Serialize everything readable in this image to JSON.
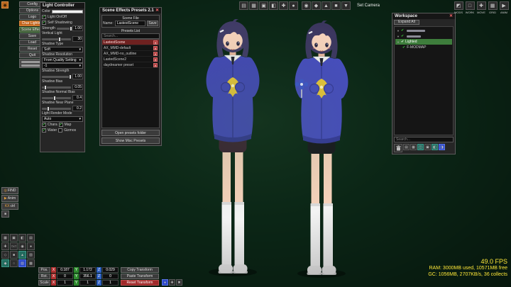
{
  "ui": {
    "dropdown_arrow": "▾",
    "check_glyph": "✔",
    "close_glyph": "✕",
    "tree_arrow": "▼"
  },
  "colors": {
    "background": "#0b2616",
    "hoodie": "#4347b5",
    "hair": "#403b66",
    "skin": "#f6d2bb",
    "shorts_left": "#3a2331",
    "shorts_right": "#17171d",
    "stats_text": "#ffe838",
    "accent_orange": "#c2641c",
    "selected_green": "#3e7d3c",
    "danger_red": "#a12a2a"
  },
  "launcher": {
    "icon": "◆"
  },
  "mod_menu": {
    "items": [
      {
        "label": "Config"
      },
      {
        "label": "Options"
      },
      {
        "label": "Logo"
      },
      {
        "label": "Char Lighting"
      },
      {
        "label": "Scene Effects"
      },
      {
        "label": "Save"
      },
      {
        "label": "Load"
      },
      {
        "label": "Reset"
      },
      {
        "label": "Quit"
      }
    ]
  },
  "light_controller": {
    "title": "Light Controller",
    "color_label": "Color",
    "light_onoff_label": "Light On/Off",
    "self_shadowing_label": "Self Shadowing",
    "strength_label": "Strength",
    "strength_value": "1.00",
    "vertical_label": "Vertical Light",
    "vertical_value": "30",
    "shadow_type_label": "Shadow Type",
    "shadow_type_value": "Soft",
    "shadow_resolution_label": "Shadow Resolution",
    "shadow_resolution_value": "From Quality Setting",
    "shadow_custom_resolution_value": "-1",
    "shadow_strength_label": "Shadow Strength",
    "shadow_strength_value": "1.00",
    "shadow_bias_label": "Shadow Bias",
    "shadow_bias_value": "0.05",
    "shadow_normal_bias_label": "Shadow Normal Bias",
    "shadow_normal_bias_value": "0.4",
    "shadow_near_plane_label": "Shadow Near Plane",
    "shadow_near_plane_value": "0.2",
    "render_mode_label": "Light Render Mode",
    "render_mode_value": "Auto",
    "chara_label": "Chara",
    "map_label": "Map",
    "water_label": "Water",
    "gizmos_label": "Gizmos"
  },
  "scene_effects": {
    "title": "Scene Effects Presets  2.1",
    "scene_file_label": "Scene File",
    "name_label": "Name:",
    "name_value": "LastestScene",
    "save_label": "Save",
    "presets_list_label": "Presets List",
    "search_placeholder": "Search...",
    "presets": [
      {
        "name": "LastestScene"
      },
      {
        "name": "AX_MMD-default"
      },
      {
        "name": "AX_MMD-no_outline"
      },
      {
        "name": "LastedScene2"
      },
      {
        "name": "daydreamer preset"
      }
    ],
    "open_folder_label": "Open presets folder",
    "show_misc_label": "Show Misc Presets"
  },
  "workspace": {
    "title": "Workspace",
    "expand_all_label": "Expand All",
    "tree": [
      {
        "label": ""
      },
      {
        "label": ""
      },
      {
        "label": "Lighted"
      },
      {
        "label": "F-MODMAP"
      }
    ],
    "search_placeholder": "Search...",
    "footer_buttons": [
      "▤",
      "▦",
      "◫",
      "▣",
      "◧",
      "◨"
    ]
  },
  "top_toolbar": {
    "set_camera_label": "Set Camera",
    "buttons": [
      "▤",
      "▦",
      "▣",
      "◧",
      "✚",
      "●",
      "◉",
      "◆",
      "▲",
      "■",
      "▼"
    ]
  },
  "right_toolbar": {
    "items": [
      {
        "icon": "◩",
        "label": "MODS"
      },
      {
        "icon": "□",
        "label": "WORK"
      },
      {
        "icon": "✚",
        "label": "MOVE"
      },
      {
        "icon": "▦",
        "label": "GRID"
      },
      {
        "icon": "▶",
        "label": "ANIM"
      }
    ]
  },
  "left_tools": {
    "stack": [
      {
        "icon": "◎",
        "label": "FIND"
      },
      {
        "icon": "▶",
        "label": "Anim"
      },
      {
        "icon": "KX",
        "label": "ctrl"
      },
      {
        "icon": "■",
        "label": ""
      }
    ],
    "grid": [
      "▦",
      "▣",
      "◧",
      "▤",
      "✚",
      "TXT",
      "◉",
      "●",
      "◇",
      "■",
      "▲",
      "▨",
      "◆",
      "○",
      "▧",
      "▩"
    ]
  },
  "transform": {
    "pos_label": "Pos.",
    "rot_label": "Rot.",
    "scale_label": "Scale",
    "axis_x": "X",
    "axis_y": "Y",
    "axis_z": "Z",
    "pos": {
      "x": "0.187",
      "y": "1.172",
      "z": "0.029"
    },
    "rot": {
      "x": "0",
      "y": "356.1",
      "z": "0"
    },
    "scale": {
      "x": "1",
      "y": "1",
      "z": "1"
    },
    "copy_label": "Copy Transform",
    "paste_label": "Paste Transform",
    "reset_label": "Reset Transform"
  },
  "misc": {
    "mini_buttons": [
      "●",
      "✚",
      "✖"
    ]
  },
  "stats": {
    "fps": "49.0 FPS",
    "ram": "RAM: 3000MB used, 10571MB free",
    "gc": "GC: 1056MB, 2707KB/s, 36 collects"
  }
}
